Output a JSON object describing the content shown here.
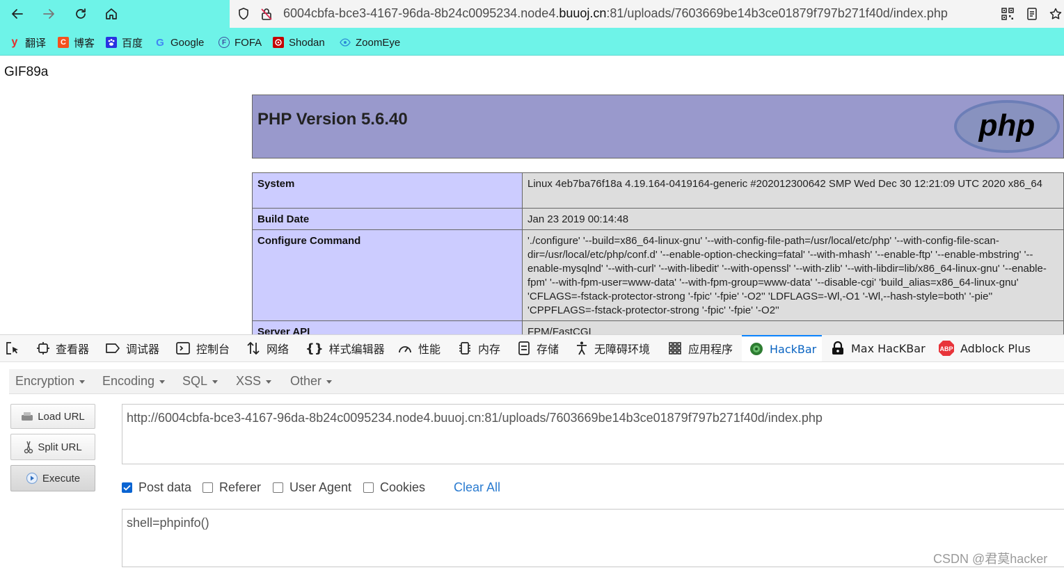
{
  "browser": {
    "url_prefix": "6004cbfa-bce3-4167-96da-8b24c0095234.node4.",
    "url_host": "buuoj.cn",
    "url_rest": ":81/uploads/7603669be14b3ce01879f797b271f40d/index.php",
    "bookmarks": [
      {
        "label": "翻译",
        "icon": "youdao-icon",
        "badge": "y",
        "color": "#e32c2c"
      },
      {
        "label": "博客",
        "icon": "csdn-icon",
        "badge": "C",
        "color": "#f4511e"
      },
      {
        "label": "百度",
        "icon": "baidu-icon",
        "badge": "",
        "color": "#2932e1"
      },
      {
        "label": "Google",
        "icon": "google-icon",
        "badge": "G",
        "color": "#4285f4"
      },
      {
        "label": "FOFA",
        "icon": "fofa-icon",
        "badge": "F",
        "color": "#3a4d9e"
      },
      {
        "label": "Shodan",
        "icon": "shodan-icon",
        "badge": "",
        "color": "#c40000"
      },
      {
        "label": "ZoomEye",
        "icon": "zoomeye-icon",
        "badge": "",
        "color": "#2b8ad6"
      }
    ]
  },
  "page": {
    "gif_header": "GIF89a",
    "php_title": "PHP Version 5.6.40",
    "php_logo_text": "php",
    "rows": [
      {
        "key": "System",
        "value": "Linux 4eb7ba76f18a 4.19.164-0419164-generic #202012300642 SMP Wed Dec 30 12:21:09 UTC 2020 x86_64"
      },
      {
        "key": "Build Date",
        "value": "Jan 23 2019 00:14:48"
      },
      {
        "key": "Configure Command",
        "value": "'./configure' '--build=x86_64-linux-gnu' '--with-config-file-path=/usr/local/etc/php' '--with-config-file-scan-dir=/usr/local/etc/php/conf.d' '--enable-option-checking=fatal' '--with-mhash' '--enable-ftp' '--enable-mbstring' '--enable-mysqlnd' '--with-curl' '--with-libedit' '--with-openssl' '--with-zlib' '--with-libdir=lib/x86_64-linux-gnu' '--enable-fpm' '--with-fpm-user=www-data' '--with-fpm-group=www-data' '--disable-cgi' 'build_alias=x86_64-linux-gnu' 'CFLAGS=-fstack-protector-strong '-fpic' '-fpie' '-O2'' 'LDFLAGS=-Wl,-O1 '-Wl,--hash-style=both' '-pie'' 'CPPFLAGS=-fstack-protector-strong '-fpic' '-fpie' '-O2''"
      },
      {
        "key": "Server API",
        "value": "FPM/FastCGI"
      }
    ]
  },
  "devtools": {
    "tabs": [
      "查看器",
      "调试器",
      "控制台",
      "网络",
      "样式编辑器",
      "性能",
      "内存",
      "存储",
      "无障碍环境",
      "应用程序",
      "HackBar",
      "Max HacKBar",
      "Adblock Plus"
    ],
    "active_tab": "HackBar"
  },
  "hackbar": {
    "menu": [
      "Encryption",
      "Encoding",
      "SQL",
      "XSS",
      "Other"
    ],
    "buttons": {
      "load": "Load URL",
      "split": "Split URL",
      "execute": "Execute"
    },
    "url_value": "http://6004cbfa-bce3-4167-96da-8b24c0095234.node4.buuoj.cn:81/uploads/7603669be14b3ce01879f797b271f40d/index.php",
    "options": [
      {
        "label": "Post data",
        "checked": true
      },
      {
        "label": "Referer",
        "checked": false
      },
      {
        "label": "User Agent",
        "checked": false
      },
      {
        "label": "Cookies",
        "checked": false
      }
    ],
    "clear_all": "Clear All",
    "post_value": "shell=phpinfo()"
  },
  "watermark": "CSDN @君莫hacker"
}
